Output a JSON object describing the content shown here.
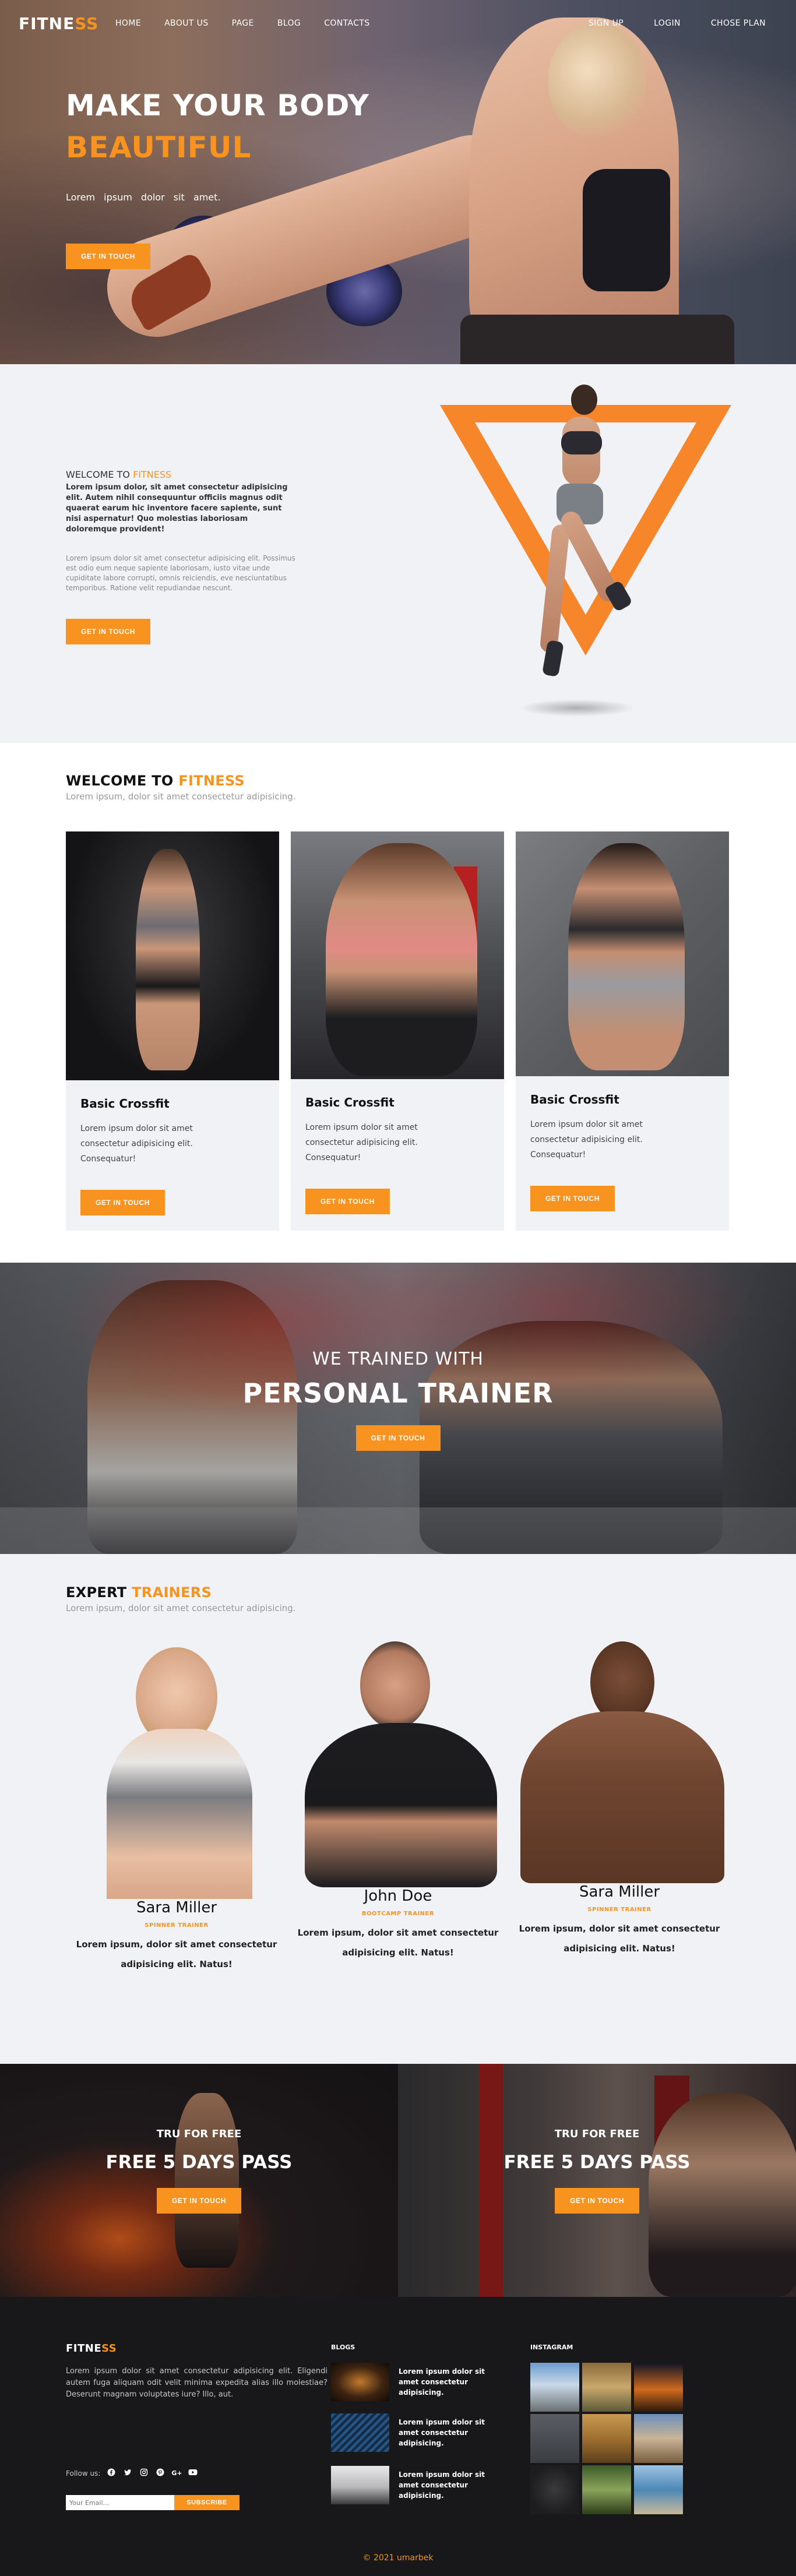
{
  "nav": {
    "logo_a": "FITNE",
    "logo_b": "SS",
    "links": [
      "HOME",
      "ABOUT US",
      "PAGE",
      "BLOG",
      "CONTACTS"
    ],
    "right_links": [
      "SIGN UP",
      "LOGIN",
      "CHOSE PLAN"
    ]
  },
  "hero": {
    "title_line1": "MAKE YOUR BODY",
    "title_line2": "BEAUTIFUL",
    "subtitle": "Lorem ipsum dolor sit amet.",
    "button": "GET IN TOUCH"
  },
  "about": {
    "eyebrow_a": "WELCOME TO ",
    "eyebrow_b": "FITNESS",
    "lead": "Lorem ipsum dolor, sit amet consectetur adipisicing elit. Autem nihil consequuntur officiis magnus odit quaerat earum hic inventore facere sapiente, sunt nisi aspernatur! Quo molestias laboriosam doloremque provident!",
    "body": "Lorem ipsum dolor sit amet consectetur adipisicing elit. Possimus est odio eum neque sapiente laboriosam, iusto vitae unde cupiditate labore corrupti, omnis reiciendis, eve nesciuntatibus temporibus. Ratione velit repudiandae nescunt.",
    "button": "GET IN TOUCH"
  },
  "programs": {
    "heading_a": "WELCOME TO ",
    "heading_b": "FITNESS",
    "subheading": "Lorem ipsum, dolor sit amet consectetur adipisicing.",
    "cards": [
      {
        "title": "Basic Crossfit",
        "desc": "Lorem ipsum dolor sit amet consectetur adipisicing elit. Consequatur!",
        "button": "GET IN TOUCH"
      },
      {
        "title": "Basic Crossfit",
        "desc": "Lorem ipsum dolor sit amet consectetur adipisicing elit. Consequatur!",
        "button": "GET IN TOUCH"
      },
      {
        "title": "Basic Crossfit",
        "desc": "Lorem ipsum dolor sit amet consectetur adipisicing elit. Consequatur!",
        "button": "GET IN TOUCH"
      }
    ]
  },
  "banner": {
    "sub": "WE TRAINED WITH",
    "main": "PERSONAL TRAINER",
    "button": "GET IN TOUCH"
  },
  "trainers": {
    "heading_a": "EXPERT ",
    "heading_b": "TRAINERS",
    "subheading": "Lorem ipsum, dolor sit amet consectetur adipisicing.",
    "items": [
      {
        "name": "Sara Miller",
        "role": "SPINNER TRAINER",
        "bio": "Lorem ipsum, dolor sit amet consectetur adipisicing elit. Natus!"
      },
      {
        "name": "John Doe",
        "role": "BOOTCAMP TRAINER",
        "bio": "Lorem ipsum, dolor sit amet consectetur adipisicing elit. Natus!"
      },
      {
        "name": "Sara Miller",
        "role": "SPINNER TRAINER",
        "bio": "Lorem ipsum, dolor sit amet consectetur adipisicing elit. Natus!"
      }
    ]
  },
  "pass": [
    {
      "sub": "TRU FOR FREE",
      "main": "FREE 5 DAYS PASS",
      "button": "GET IN TOUCH"
    },
    {
      "sub": "TRU FOR FREE",
      "main": "FREE 5 DAYS PASS",
      "button": "GET IN TOUCH"
    }
  ],
  "footer": {
    "logo_a": "FITNE",
    "logo_b": "SS",
    "desc": "Lorem ipsum dolor sit amet consectetur adipisicing elit. Eligendi autem fuga aliquam odit velit minima expedita alias illo molestiae? Deserunt magnam voluptates iure? Illo, aut.",
    "follow_label": "Follow us:",
    "social_icons": [
      "facebook-icon",
      "twitter-icon",
      "instagram-icon",
      "pinterest-icon",
      "google-plus-icon",
      "youtube-icon"
    ],
    "email_placeholder": "Your Email...",
    "subscribe": "SUBSCRIBE",
    "blogs_title": "BLOGS",
    "blogs": [
      "Lorem ipsum dolor sit amet consectetur adipisicing.",
      "Lorem ipsum dolor sit amet consectetur adipisicing.",
      "Lorem ipsum dolor sit amet consectetur adipisicing."
    ],
    "instagram_title": "INSTAGRAM",
    "copyright": "© 2021 umarbek"
  },
  "colors": {
    "accent": "#f7931e",
    "footer_bg": "#18171a",
    "light_bg": "#f0f2f6"
  }
}
